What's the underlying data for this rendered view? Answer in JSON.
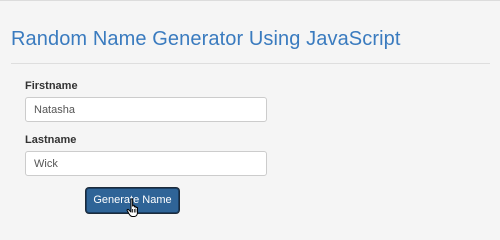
{
  "header": {
    "title": "Random Name Generator Using JavaScript"
  },
  "form": {
    "firstname": {
      "label": "Firstname",
      "value": "Natasha"
    },
    "lastname": {
      "label": "Lastname",
      "value": "Wick"
    },
    "generate_button_label": "Generate Name"
  },
  "cursor": {
    "icon": "hand-pointer-icon"
  },
  "colors": {
    "title": "#3a7bbf",
    "button_background": "#2f6497",
    "page_background": "#f5f5f5"
  }
}
